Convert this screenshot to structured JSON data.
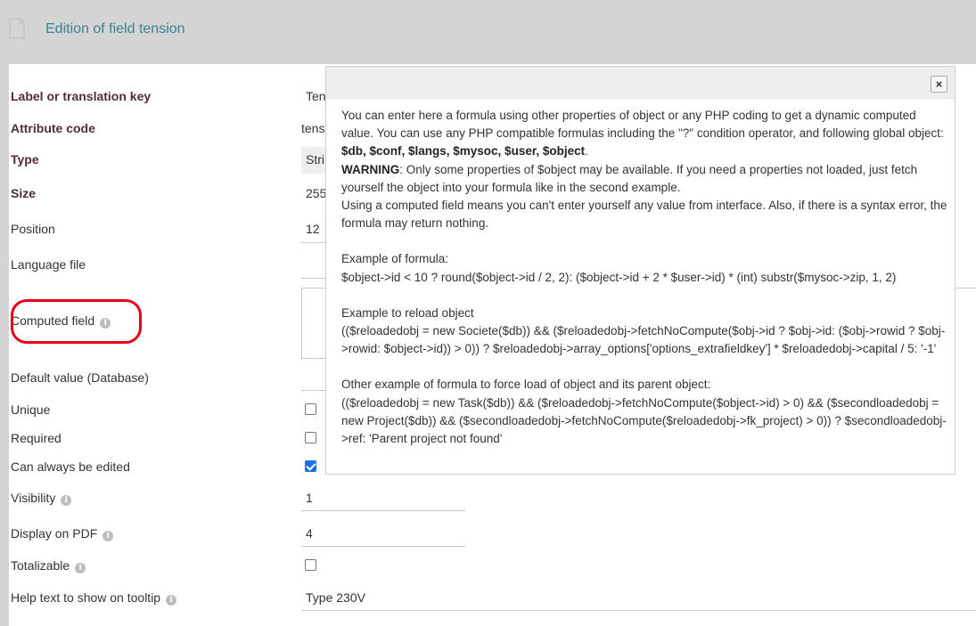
{
  "header": {
    "title": "Edition of field tension"
  },
  "form": {
    "label_key": {
      "label": "Label or translation key",
      "value": "Ten"
    },
    "attribute_code": {
      "label": "Attribute code",
      "value": "tens"
    },
    "type": {
      "label": "Type",
      "value": "Stri"
    },
    "size": {
      "label": "Size",
      "value": "255"
    },
    "position": {
      "label": "Position",
      "value": "12"
    },
    "language_file": {
      "label": "Language file"
    },
    "computed_field": {
      "label": "Computed field"
    },
    "default_value": {
      "label": "Default value (Database)"
    },
    "unique": {
      "label": "Unique",
      "checked": false
    },
    "required": {
      "label": "Required",
      "checked": false
    },
    "can_always_be_edited": {
      "label": "Can always be edited",
      "checked": true
    },
    "visibility": {
      "label": "Visibility",
      "value": "1"
    },
    "display_on_pdf": {
      "label": "Display on PDF",
      "value": "4"
    },
    "totalizable": {
      "label": "Totalizable",
      "checked": false
    },
    "help_text": {
      "label": "Help text to show on tooltip",
      "value": "Type 230V"
    }
  },
  "dialog": {
    "close_label": "×",
    "p1": "You can enter here a formula using other properties of object or any PHP coding to get a dynamic computed value. You can use any PHP compatible formulas including the \"?\" condition operator, and following global object: ",
    "p1_objects": "$db, $conf, $langs, $mysoc, $user, $object",
    "p1_end": ".",
    "warning_label": "WARNING",
    "warning_text": ": Only some properties of $object may be available. If you need a properties not loaded, just fetch yourself the object into your formula like in the second example.",
    "p3": "Using a computed field means you can't enter yourself any value from interface. Also, if there is a syntax error, the formula may return nothing.",
    "ex1_title": "Example of formula:",
    "ex1_code": "$object->id < 10 ? round($object->id / 2, 2): ($object->id + 2 * $user->id) * (int) substr($mysoc->zip, 1, 2)",
    "ex2_title": "Example to reload object",
    "ex2_code": "(($reloadedobj = new Societe($db)) && ($reloadedobj->fetchNoCompute($obj->id ? $obj->id: ($obj->rowid ? $obj->rowid: $object->id)) > 0)) ? $reloadedobj->array_options['options_extrafieldkey'] * $reloadedobj->capital / 5: '-1'",
    "ex3_title": "Other example of formula to force load of object and its parent object:",
    "ex3_code": "(($reloadedobj = new Task($db)) && ($reloadedobj->fetchNoCompute($object->id) > 0) && ($secondloadedobj = new Project($db)) && ($secondloadedobj->fetchNoCompute($reloadedobj->fk_project) > 0)) ? $secondloadedobj->ref: 'Parent project not found'"
  },
  "icons": {
    "page": "page-icon",
    "info": "info-icon",
    "close": "close-icon"
  },
  "colors": {
    "title": "#3f8091",
    "label_bold": "#4d2d3c",
    "highlight": "#e2001a",
    "checkbox": "#1a73e8"
  }
}
